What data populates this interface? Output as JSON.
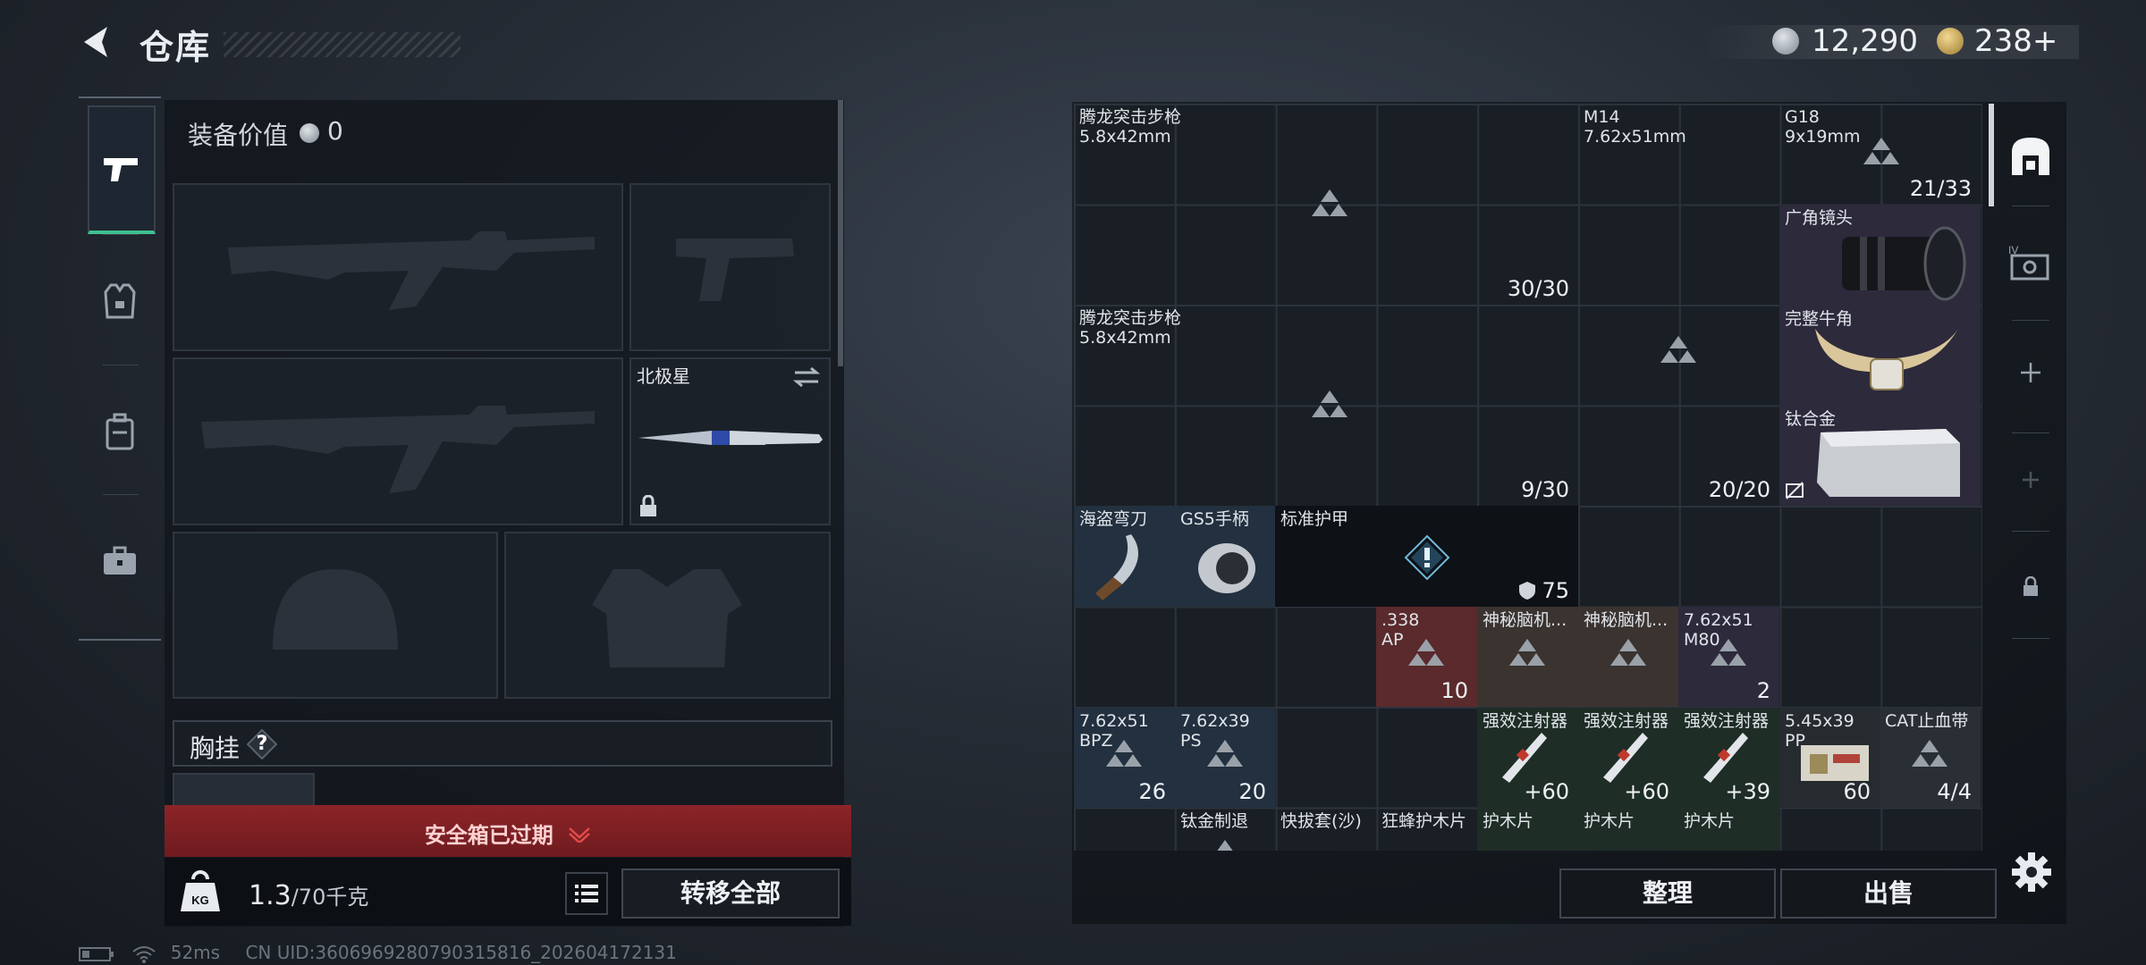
{
  "header": {
    "title": "仓库",
    "currency_silver": "12,290",
    "currency_gold": "238+"
  },
  "left": {
    "value_label": "装备价值",
    "value_num": "0",
    "melee_name": "北极星",
    "rig_label": "胸挂",
    "rig_help": "?",
    "warning": "安全箱已过期",
    "weight_value": "1.3",
    "weight_max": "/70千克",
    "transfer_all": "转移全部"
  },
  "status": {
    "ping": "52ms",
    "uid": "CN UID:3606969280790315816_202604172131"
  },
  "grid": {
    "items": {
      "rifle1": {
        "name": "腾龙突击步枪",
        "sub": "5.8x42mm",
        "count": "30/30"
      },
      "m14": {
        "name": "M14",
        "sub": "7.62x51mm"
      },
      "g18": {
        "name": "G18",
        "sub": "9x19mm",
        "count": "21/33"
      },
      "lens": {
        "name": "广角镜头"
      },
      "horn": {
        "name": "完整牛角"
      },
      "titanium": {
        "name": "钛合金"
      },
      "rifle2": {
        "name": "腾龙突击步枪",
        "sub": "5.8x42mm",
        "count": "9/30"
      },
      "cutlass": {
        "name": "海盗弯刀"
      },
      "gs5": {
        "name": "GS5手柄"
      },
      "armor": {
        "name": "标准护甲",
        "durability": "75"
      },
      "m14mag": {
        "count": "20/20"
      },
      "ap338": {
        "name": ".338",
        "sub": "AP",
        "count": "10"
      },
      "brain1": {
        "name": "神秘脑机..."
      },
      "brain2": {
        "name": "神秘脑机..."
      },
      "m80": {
        "name": "7.62x51",
        "sub": "M80",
        "count": "2"
      },
      "bpz": {
        "name": "7.62x51",
        "sub": "BPZ",
        "count": "26"
      },
      "ps": {
        "name": "7.62x39",
        "sub": "PS",
        "count": "20"
      },
      "inj1": {
        "name": "强效注射器",
        "count": "+60"
      },
      "inj2": {
        "name": "强效注射器",
        "count": "+60"
      },
      "inj3": {
        "name": "强效注射器",
        "count": "+39"
      },
      "pp545": {
        "name": "5.45x39",
        "sub": "PP",
        "count": "60"
      },
      "cat": {
        "name": "CAT止血带",
        "count": "4/4"
      },
      "ti_ret": {
        "name": "钛金制退"
      },
      "holster": {
        "name": "快拔套(沙)"
      },
      "wasp": {
        "name": "狂蜂护木片"
      },
      "guard1": {
        "name": "护木片"
      },
      "guard2": {
        "name": "护木片"
      },
      "guard3": {
        "name": "护木片"
      }
    }
  },
  "actions": {
    "sort": "整理",
    "sell": "出售"
  },
  "colors": {
    "accent_green": "#3fc08f",
    "warning_red": "#8c2428",
    "ammo_red": "#5a2a2c",
    "ammo_blue": "#22303f",
    "med_green": "#1e2d26",
    "purple": "#2d2a3c"
  }
}
